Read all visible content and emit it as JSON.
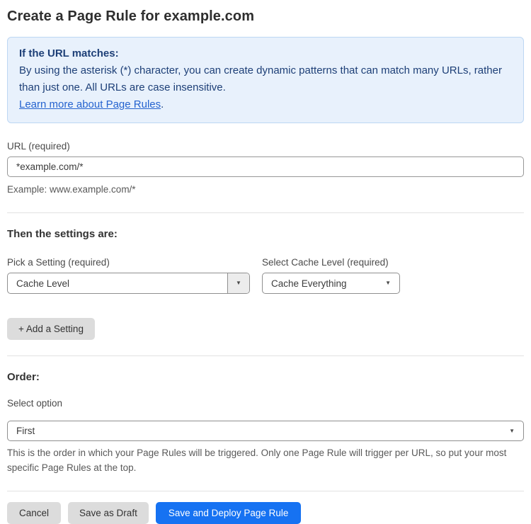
{
  "page": {
    "title": "Create a Page Rule for example.com"
  },
  "info_box": {
    "heading": "If the URL matches:",
    "body": "By using the asterisk (*) character, you can create dynamic patterns that can match many URLs, rather than just one. All URLs are case insensitive.",
    "link_label": "Learn more about Page Rules",
    "link_suffix": "."
  },
  "url_field": {
    "label": "URL (required)",
    "value": "*example.com/*",
    "helper": "Example: www.example.com/*"
  },
  "settings_section": {
    "heading": "Then the settings are:",
    "setting_picker": {
      "label": "Pick a Setting (required)",
      "value": "Cache Level"
    },
    "cache_level_picker": {
      "label": "Select Cache Level (required)",
      "value": "Cache Everything"
    },
    "add_setting_label": "+ Add a Setting"
  },
  "order_section": {
    "heading": "Order:",
    "label": "Select option",
    "value": "First",
    "helper": "This is the order in which your Page Rules will be triggered. Only one Page Rule will trigger per URL, so put your most specific Page Rules at the top."
  },
  "footer": {
    "cancel_label": "Cancel",
    "save_draft_label": "Save as Draft",
    "save_deploy_label": "Save and Deploy Page Rule"
  },
  "colors": {
    "accent_blue": "#1672f2",
    "info_bg": "#e8f1fc",
    "info_border": "#bdd7f3",
    "info_text": "#1d3f77",
    "link_blue": "#2563cf",
    "button_gray": "#dcdcdc"
  },
  "icons": {
    "dropdown_arrow": "▼"
  }
}
